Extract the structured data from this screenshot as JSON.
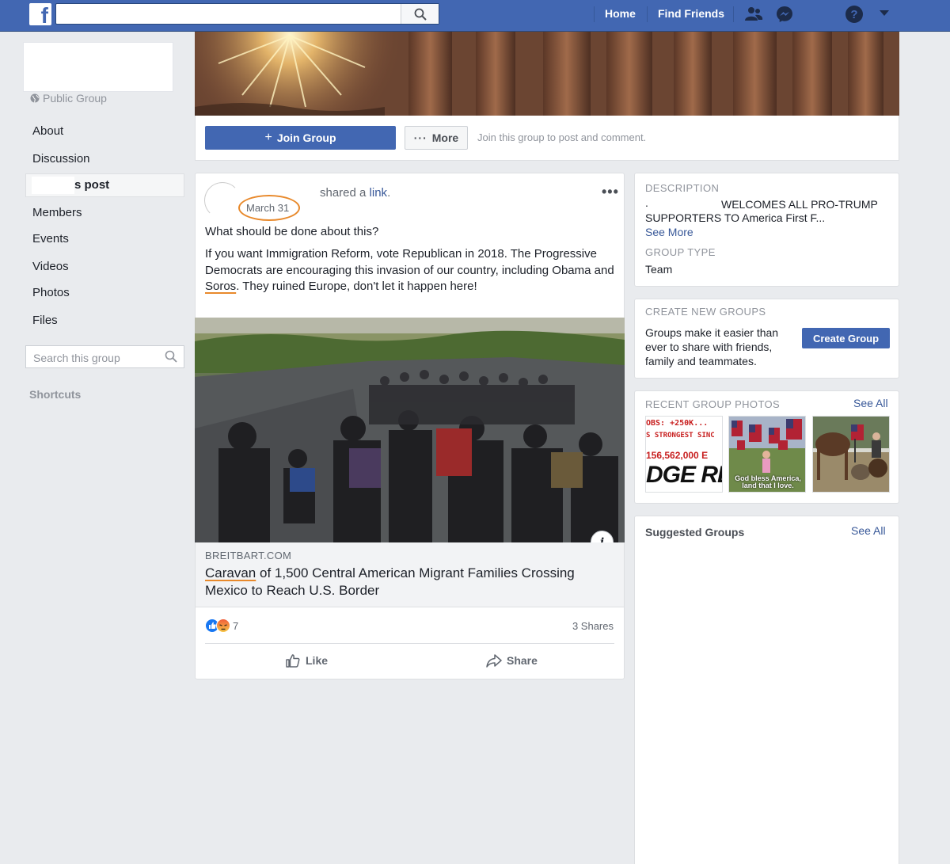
{
  "topbar": {
    "logo": "f",
    "search_placeholder": "",
    "nav": [
      "Home",
      "Find Friends"
    ],
    "icons": [
      "friend-requests-icon",
      "messenger-icon",
      "help-icon",
      "account-menu-icon"
    ]
  },
  "left": {
    "privacy": "Public Group",
    "nav": [
      "About",
      "Discussion",
      "s post",
      "Members",
      "Events",
      "Videos",
      "Photos",
      "Files"
    ],
    "search_placeholder": "Search this group",
    "shortcuts": "Shortcuts"
  },
  "join_bar": {
    "join_label": "Join Group",
    "more_label": "More",
    "hint": "Join this group to post and comment."
  },
  "post": {
    "date": "March 31",
    "shared_prefix": "shared a",
    "shared_link": "link",
    "shared_suffix": ".",
    "question": "What should be done about this?",
    "body_before": "If you want Immigration Reform, vote Republican in 2018. The Progressive Democrats are encouraging this invasion of our country, including Obama and ",
    "body_soros": "Soros",
    "body_after": ". They ruined Europe, don't let it happen here!",
    "domain": "BREITBART.COM",
    "headline_caravan": "Caravan",
    "headline_rest": " of 1,500 Central American Migrant Families Crossing Mexico to Reach U.S. Border",
    "reaction_count": "7",
    "shares": "3 Shares",
    "like_label": "Like",
    "share_label": "Share",
    "info": "i"
  },
  "description": {
    "head": "DESCRIPTION",
    "line1_prefix": ".",
    "line1": "WELCOMES ALL PRO-TRUMP",
    "line2": "SUPPORTERS TO America First F...",
    "see_more": "See More",
    "type_head": "GROUP TYPE",
    "type_value": "Team"
  },
  "create_groups": {
    "head": "CREATE NEW GROUPS",
    "text": "Groups make it easier than ever to share with friends, family and teammates.",
    "button": "Create Group"
  },
  "photos": {
    "head": "RECENT GROUP PHOTOS",
    "see_all": "See All",
    "thumb1_lines": [
      "OBS: +250K...",
      "S STRONGEST SINC",
      "156,562,000 E",
      "DGE REI"
    ],
    "thumb2_caption": "God bless America, land that I love."
  },
  "suggested": {
    "head": "Suggested Groups",
    "see_all": "See All"
  },
  "colors": {
    "brand": "#4267b2",
    "link": "#385898",
    "annotation": "#e8892b"
  }
}
